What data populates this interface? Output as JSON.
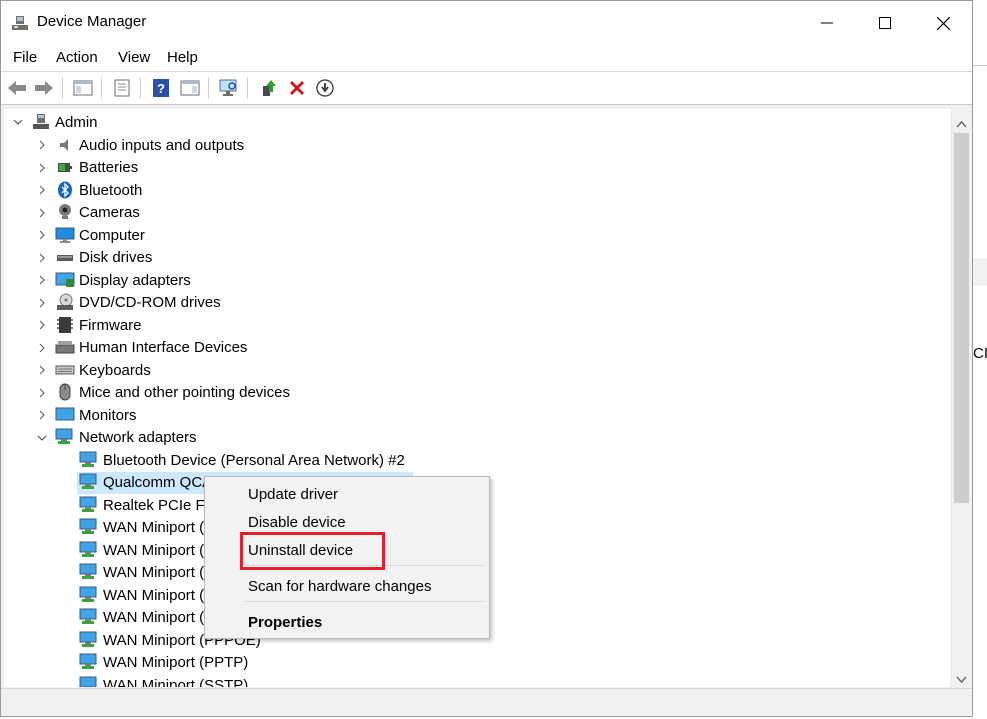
{
  "window": {
    "title": "Device Manager"
  },
  "menu": [
    "File",
    "Action",
    "View",
    "Help"
  ],
  "toolbar": [
    "back-icon",
    "forward-icon",
    "show-hide-console-tree-icon",
    "properties-icon",
    "help-icon",
    "action-pane-icon",
    "scan-for-hardware-changes-icon",
    "update-driver-icon",
    "uninstall-device-icon",
    "disable-device-icon"
  ],
  "tree": {
    "root": "Admin",
    "categories": [
      "Audio inputs and outputs",
      "Batteries",
      "Bluetooth",
      "Cameras",
      "Computer",
      "Disk drives",
      "Display adapters",
      "DVD/CD-ROM drives",
      "Firmware",
      "Human Interface Devices",
      "Keyboards",
      "Mice and other pointing devices",
      "Monitors",
      "Network adapters"
    ],
    "network_adapters": [
      "Bluetooth Device (Personal Area Network) #2",
      "Qualcomm QCA",
      "Realtek PCIe FE",
      "WAN Miniport (",
      "WAN Miniport (",
      "WAN Miniport (",
      "WAN Miniport (",
      "WAN Miniport (",
      "WAN Miniport (PPPOE)",
      "WAN Miniport (PPTP)",
      "WAN Miniport (SSTP)"
    ],
    "selected": "Qualcomm QCA"
  },
  "context_menu": {
    "update_driver": "Update driver",
    "disable_device": "Disable device",
    "uninstall_device": "Uninstall device",
    "scan": "Scan for hardware changes",
    "properties": "Properties"
  },
  "background": {
    "edge_text": "CI"
  },
  "colors": {
    "selection": "#cce8ff",
    "highlight_box": "#e0202a",
    "menu_bg": "#f2f2f2"
  }
}
